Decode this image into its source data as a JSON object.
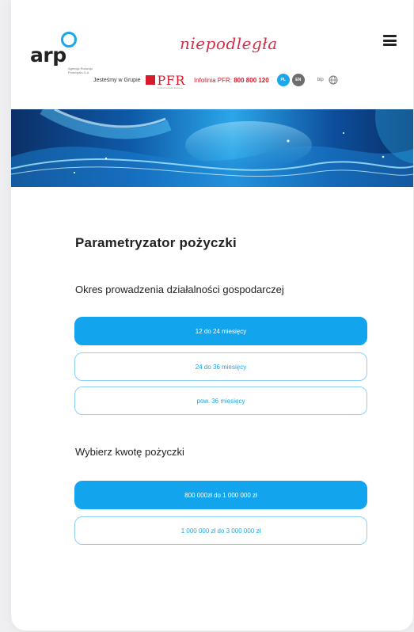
{
  "header": {
    "logo_text": "arp",
    "logo_subtitle": "Agencja Rozwoju Przemysłu S.A.",
    "brand_script": "niepodległa",
    "group_text": "Jesteśmy w Grupie",
    "pfr_name": "PFR",
    "pfr_subtitle": "Polski Fundusz Rozwoju",
    "infolinia_label": "Infolinia PFR:",
    "infolinia_number": "800 800 120",
    "lang_pl": "PL",
    "lang_en": "EN",
    "bip_label": "bip"
  },
  "main": {
    "title": "Parametryzator pożyczki",
    "period_label": "Okres prowadzenia działalności gospodarczej",
    "period_options": [
      "12 do 24 miesięcy",
      "24 do 36 miesięcy",
      "pow. 36 miesięcy"
    ],
    "period_selected": "12 do 24 miesięcy",
    "amount_label": "Wybierz kwotę pożyczki",
    "amount_options": [
      "800 000zł do 1 000 000 zł",
      "1 000 000 zł do 3 000 000 zł"
    ],
    "amount_selected": "800 000zł do 1 000 000 zł"
  },
  "colors": {
    "accent": "#13a4ee",
    "brand_red": "#d51b2c",
    "script_red": "#d3304a"
  },
  "icons": [
    "menu-icon",
    "globe-icon"
  ]
}
